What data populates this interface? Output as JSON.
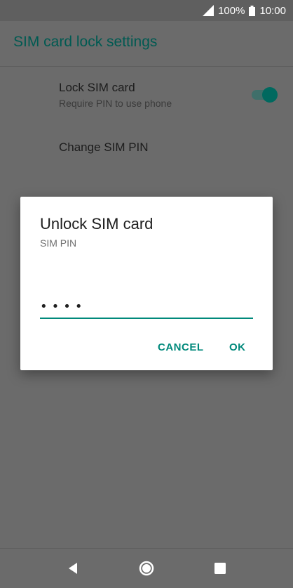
{
  "status": {
    "battery_text": "100%",
    "time": "10:00",
    "icons": [
      "signal-icon",
      "battery-icon"
    ]
  },
  "toolbar": {
    "title": "SIM card lock settings"
  },
  "settings": {
    "lock_sim": {
      "title": "Lock SIM card",
      "subtitle": "Require PIN to use phone",
      "enabled": true
    },
    "change_pin": {
      "title": "Change SIM PIN"
    }
  },
  "dialog": {
    "title": "Unlock SIM card",
    "subtitle": "SIM PIN",
    "pin_value": "••••",
    "cancel_label": "CANCEL",
    "ok_label": "OK"
  },
  "nav": {
    "icons": [
      "back-icon",
      "home-icon",
      "recents-icon"
    ]
  },
  "colors": {
    "accent": "#00897b",
    "toolbar_title": "#005a52",
    "scrim_background": "#6b6b6b",
    "dialog_background": "#ffffff"
  }
}
